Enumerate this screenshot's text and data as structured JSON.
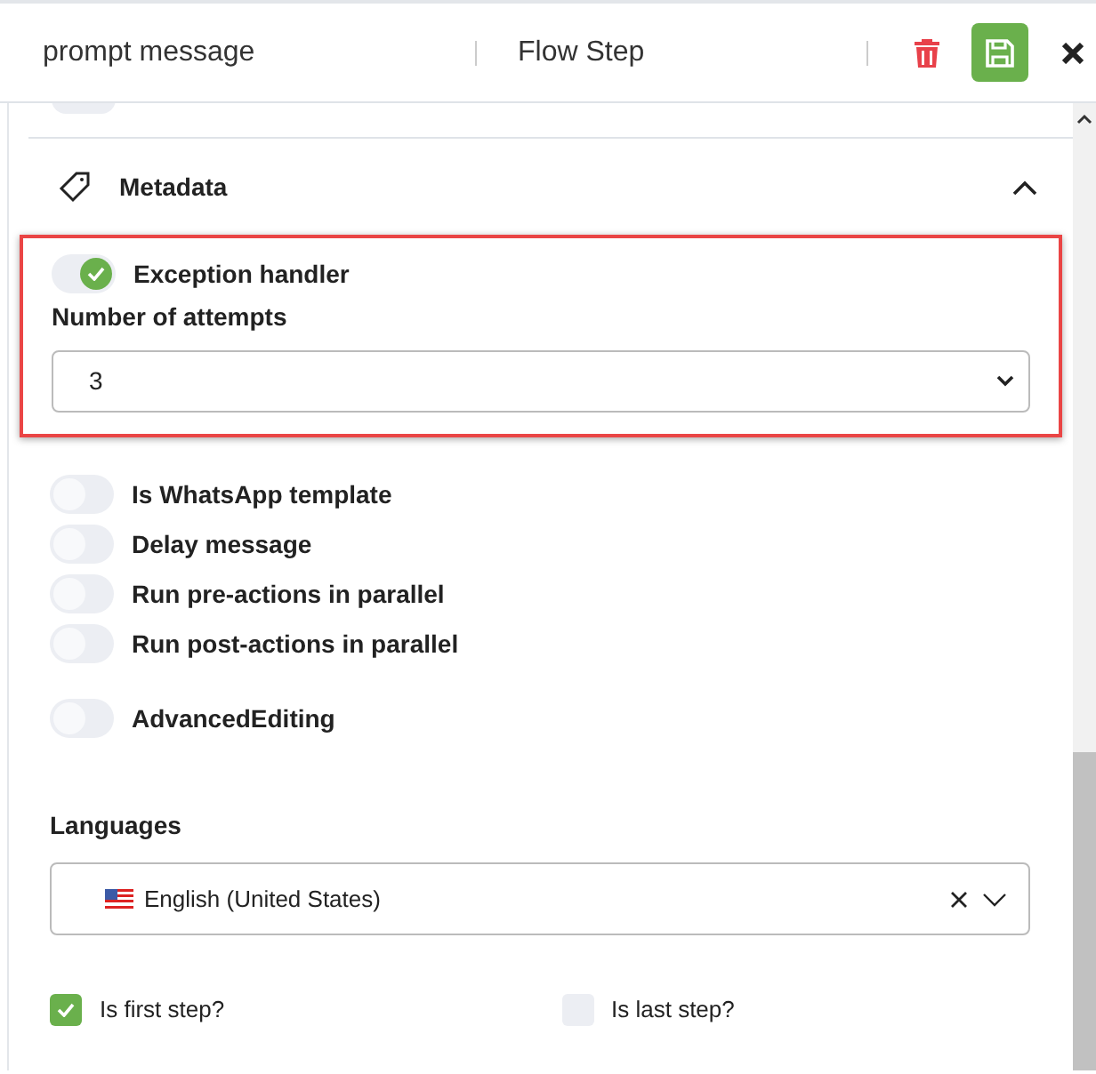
{
  "header": {
    "title": "prompt message",
    "subtitle": "Flow Step"
  },
  "cut_toggle": {
    "on": false
  },
  "section": {
    "title": "Metadata",
    "expanded": true
  },
  "highlight": {
    "shown": true
  },
  "exception_handler": {
    "label": "Exception handler",
    "on": true
  },
  "attempts": {
    "label": "Number of attempts",
    "value": "3"
  },
  "toggles": [
    {
      "label": "Is WhatsApp template",
      "on": false
    },
    {
      "label": "Delay message",
      "on": false
    },
    {
      "label": "Run pre-actions in parallel",
      "on": false
    },
    {
      "label": "Run post-actions in parallel",
      "on": false
    },
    {
      "label": "AdvancedEditing",
      "on": false
    }
  ],
  "languages": {
    "label": "Languages",
    "value": "English (United States)"
  },
  "checkboxes": [
    {
      "label": "Is first step?",
      "checked": true
    },
    {
      "label": "Is last step?",
      "checked": false
    }
  ]
}
